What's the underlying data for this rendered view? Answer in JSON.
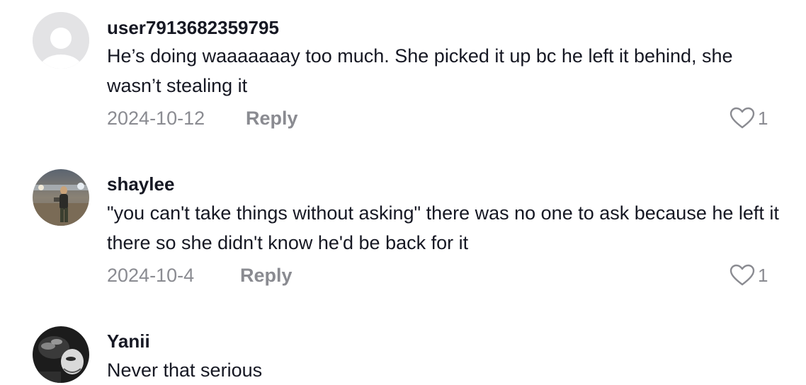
{
  "comments": [
    {
      "username": "user7913682359795",
      "text": "He’s doing waaaaaaay too much. She picked it up bc he left it behind, she wasn’t stealing it",
      "date": "2024-10-12",
      "reply_label": "Reply",
      "likes": "1",
      "avatar_icon": "default-avatar-icon"
    },
    {
      "username": "shaylee",
      "text": "\"you can't take things without asking\" there was no one to ask because he left it there so she didn't know he'd be back for it",
      "date": "2024-10-4",
      "reply_label": "Reply",
      "likes": "1",
      "avatar_icon": "photo-avatar"
    },
    {
      "username": "Yanii",
      "text": "Never that serious",
      "avatar_icon": "photo-avatar"
    }
  ],
  "colors": {
    "text": "#161823",
    "muted": "#8a8b91",
    "avatar_placeholder_bg": "#e3e3e5"
  }
}
